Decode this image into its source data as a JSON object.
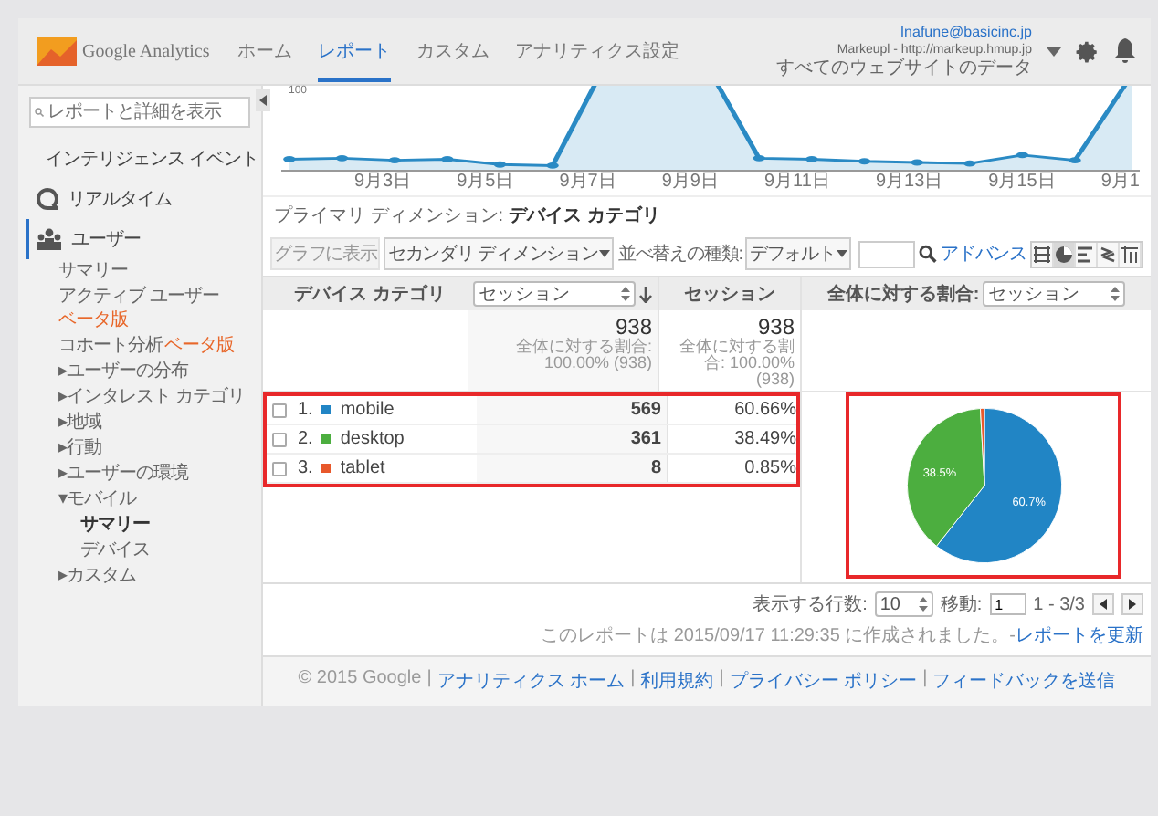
{
  "header": {
    "logo": "Google Analytics",
    "tabs": [
      {
        "label": "ホーム",
        "selected": false
      },
      {
        "label": "レポート",
        "selected": true
      },
      {
        "label": "カスタム",
        "selected": false
      },
      {
        "label": "アナリティクス設定",
        "selected": false
      }
    ],
    "account": {
      "email": "Inafune@basicinc.jp",
      "property": "Markeupl - http://markeup.hmup.jp",
      "view": "すべてのウェブサイトのデータ"
    }
  },
  "sidebar": {
    "search": {
      "placeholder": "レポートと詳細を表示"
    },
    "sections": [
      {
        "label": "インテリジェンス イベント",
        "kind": "intelligence",
        "selected": false
      },
      {
        "label": "リアルタイム",
        "kind": "realtime",
        "selected": false
      },
      {
        "label": "ユーザー",
        "kind": "audience",
        "selected": true
      }
    ],
    "items": [
      {
        "label": "サマリー",
        "selected": false
      },
      {
        "label": "アクティブ ユーザー",
        "badge": "ベータ版",
        "selected": false
      },
      {
        "label": "コホート分析",
        "badge": "ベータ版",
        "selected": false
      },
      {
        "marker": "▸",
        "label": "ユーザーの分布",
        "selected": false
      },
      {
        "marker": "▸",
        "label": "インタレスト カテゴリ",
        "selected": false
      },
      {
        "marker": "▸",
        "label": "地域",
        "selected": false
      },
      {
        "marker": "▸",
        "label": "行動",
        "selected": false
      },
      {
        "marker": "▸",
        "label": "ユーザーの環境",
        "selected": false
      },
      {
        "marker": "▾",
        "label": "モバイル",
        "selected": false,
        "children": [
          {
            "label": "サマリー",
            "selected": true
          },
          {
            "label": "デバイス",
            "selected": false
          }
        ]
      },
      {
        "marker": "▸",
        "label": "カスタム",
        "selected": false
      }
    ]
  },
  "trend": {
    "y_tick": "100",
    "x_labels": [
      "9月3日",
      "9月5日",
      "9月7日",
      "9月9日",
      "9月11日",
      "9月13日",
      "9月15日",
      "9月1"
    ]
  },
  "primary_dimension": {
    "label": "プライマリ ディメンション:",
    "value": "デバイス カテゴリ"
  },
  "toolbar": {
    "plot_button": {
      "label": "グラフに表示",
      "disabled": true
    },
    "secondary": "セカンダリ ディメンション",
    "sort_label": "並べ替えの種類:",
    "sort": "デフォルト",
    "advanced": "アドバンス",
    "views": [
      {
        "kind": "table",
        "selected": false
      },
      {
        "kind": "pie",
        "selected": true
      },
      {
        "kind": "bar",
        "selected": false
      },
      {
        "kind": "compare",
        "selected": false
      },
      {
        "kind": "pivot",
        "selected": false
      }
    ]
  },
  "table": {
    "dimension_header": "デバイス カテゴリ",
    "metric_select": "セッション",
    "metric_header": "セッション",
    "share_label": "全体に対する割合:",
    "share_select": "セッション",
    "totals": {
      "value": "938",
      "note": "全体に対する割合: 100.00% (938)",
      "value2": "938",
      "note2": "全体に対する割合: 100.00% (938)"
    },
    "rows": [
      {
        "rank": "1.",
        "name": "mobile",
        "color": "#2185c5",
        "sessions": "569",
        "share": "60.66%",
        "checked": false
      },
      {
        "rank": "2.",
        "name": "desktop",
        "color": "#4cae3f",
        "sessions": "361",
        "share": "38.49%",
        "checked": false
      },
      {
        "rank": "3.",
        "name": "tablet",
        "color": "#e8582b",
        "sessions": "8",
        "share": "0.85%",
        "checked": false
      }
    ],
    "chart_data": {
      "type": "pie",
      "values": [
        60.66,
        38.49,
        0.85
      ],
      "value_labels": [
        "60.7%",
        "38.5%",
        null
      ]
    }
  },
  "pagination": {
    "rows_label": "表示する行数:",
    "rows": "10",
    "goto_label": "移動:",
    "goto": "1",
    "range": "1 - 3/3"
  },
  "report_note": {
    "text": "このレポートは 2015/09/17 11:29:35 に作成されました。-",
    "link": "レポートを更新"
  },
  "footer": [
    {
      "kind": "text",
      "text": "© 2015 Google"
    },
    {
      "kind": "separator",
      "text": "|"
    },
    {
      "kind": "link",
      "text": "アナリティクス ホーム"
    },
    {
      "kind": "separator",
      "text": "|"
    },
    {
      "kind": "link",
      "text": "利用規約"
    },
    {
      "kind": "separator",
      "text": "|"
    },
    {
      "kind": "link",
      "text": "プライバシー ポリシー"
    },
    {
      "kind": "separator",
      "text": "|"
    },
    {
      "kind": "link",
      "text": "フィードバックを送信"
    }
  ]
}
